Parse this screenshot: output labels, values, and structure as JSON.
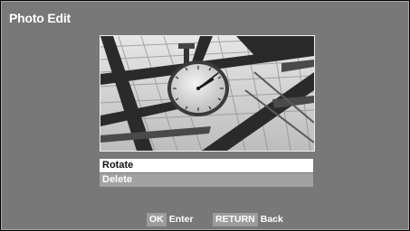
{
  "header": {
    "title": "Photo Edit"
  },
  "photo": {
    "subject": "clock-under-steel-roof-photo"
  },
  "menu": {
    "items": [
      {
        "label": "Rotate",
        "state": "selected"
      },
      {
        "label": "Delete",
        "state": "normal"
      }
    ]
  },
  "footer": {
    "ok_key": "OK",
    "ok_label": "Enter",
    "return_key": "RETURN",
    "return_label": "Back"
  },
  "colors": {
    "background": "#787878",
    "selected_item": "#ffffff",
    "normal_item": "#a2a2a2",
    "key_badge": "#9c9c9c"
  }
}
